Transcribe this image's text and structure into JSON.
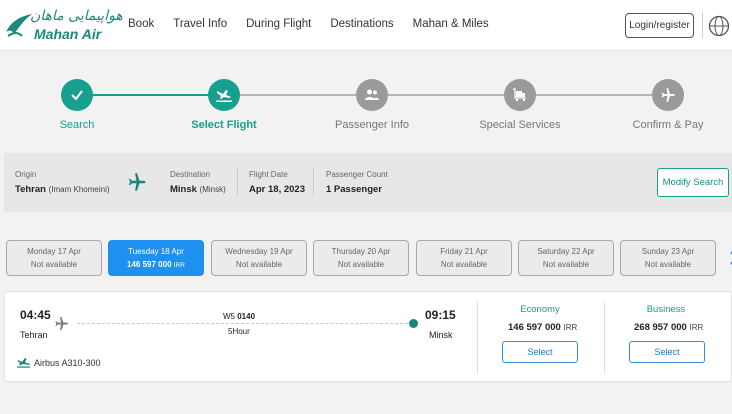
{
  "header": {
    "logo_script": "هواپیمایی ماهان",
    "logo_text": "Mahan Air",
    "nav": [
      "Book",
      "Travel Info",
      "During Flight",
      "Destinations",
      "Mahan & Miles"
    ],
    "login_label": "Login/register",
    "globe_icon": "globe-icon"
  },
  "stepper": {
    "active_color": "#17a08f",
    "inactive_color": "#9a9a9a",
    "steps": [
      {
        "label": "Search",
        "icon": "check-icon",
        "state": "done"
      },
      {
        "label": "Select Flight",
        "icon": "plane-landing-icon",
        "state": "current"
      },
      {
        "label": "Passenger Info",
        "icon": "users-icon",
        "state": "pending"
      },
      {
        "label": "Special Services",
        "icon": "luggage-cart-icon",
        "state": "pending"
      },
      {
        "label": "Confirm & Pay",
        "icon": "plane-icon",
        "state": "pending"
      }
    ]
  },
  "summary": {
    "origin_label": "Origin",
    "origin_city": "Tehran",
    "origin_airport": "(Imam Khomeini)",
    "destination_label": "Destination",
    "destination_city": "Minsk",
    "destination_airport": "(Minsk)",
    "date_label": "Flight Date",
    "date_value": "Apr 18, 2023",
    "pax_label": "Passenger Count",
    "pax_value": "1 Passenger",
    "modify_label": "Modify Search"
  },
  "dates": [
    {
      "day": "Monday 17 Apr",
      "status": "Not available",
      "active": false
    },
    {
      "day": "Tuesday 18 Apr",
      "price": "146 597 000",
      "currency": "IRR",
      "active": true
    },
    {
      "day": "Wednesday 19 Apr",
      "status": "Not available",
      "active": false
    },
    {
      "day": "Thursday 20 Apr",
      "status": "Not available",
      "active": false
    },
    {
      "day": "Friday 21 Apr",
      "status": "Not available",
      "active": false
    },
    {
      "day": "Saturday 22 Apr",
      "status": "Not available",
      "active": false
    },
    {
      "day": "Sunday 23 Apr",
      "status": "Not available",
      "active": false
    }
  ],
  "flight": {
    "dep_time": "04:45",
    "dep_city": "Tehran",
    "arr_time": "09:15",
    "arr_city": "Minsk",
    "flight_prefix": "W5",
    "flight_number": "0140",
    "duration": "5Hour",
    "aircraft": "Airbus A310-300",
    "economy_title": "Economy",
    "economy_price": "146 597 000",
    "economy_currency": "IRR",
    "business_title": "Business",
    "business_price": "268 957 000",
    "business_currency": "IRR",
    "select_label": "Select"
  }
}
